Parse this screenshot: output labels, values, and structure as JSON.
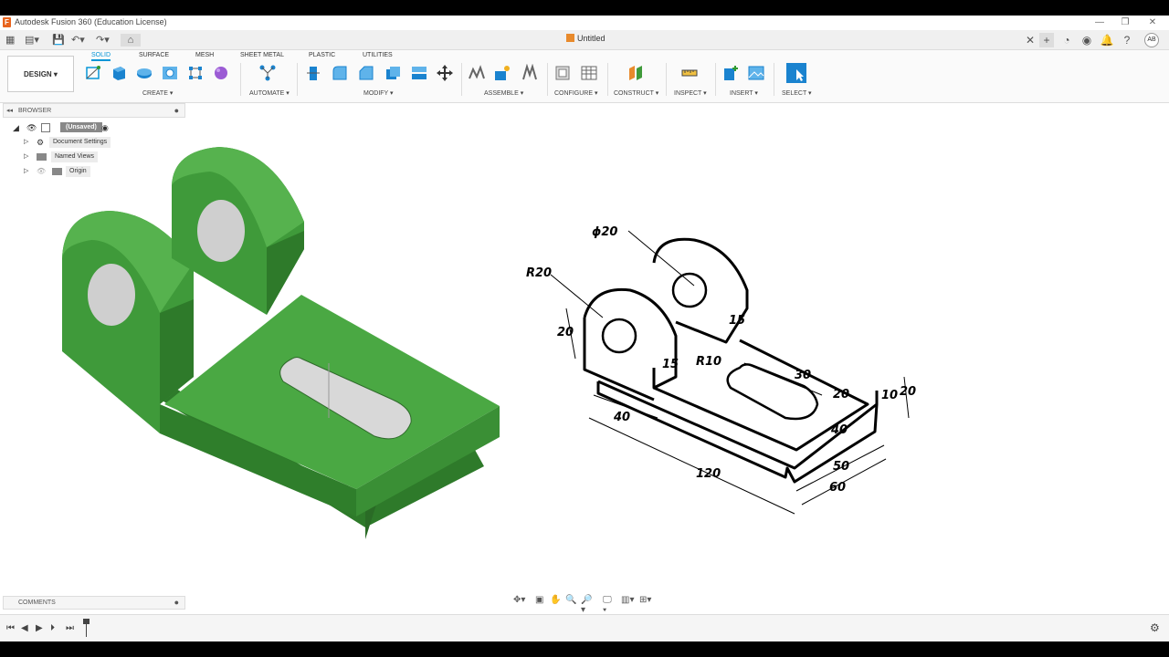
{
  "window": {
    "title": "Autodesk Fusion 360 (Education License)"
  },
  "document": {
    "title": "Untitled"
  },
  "user": {
    "initials": "AB"
  },
  "workspace": {
    "label": "DESIGN"
  },
  "tabs": [
    "SOLID",
    "SURFACE",
    "MESH",
    "SHEET METAL",
    "PLASTIC",
    "UTILITIES"
  ],
  "groups": {
    "create": "CREATE",
    "automate": "AUTOMATE",
    "modify": "MODIFY",
    "assemble": "ASSEMBLE",
    "configure": "CONFIGURE",
    "construct": "CONSTRUCT",
    "inspect": "INSPECT",
    "insert": "INSERT",
    "select": "SELECT"
  },
  "browser": {
    "title": "BROWSER",
    "root": "(Unsaved)",
    "items": [
      "Document Settings",
      "Named Views",
      "Origin"
    ]
  },
  "comments": {
    "title": "COMMENTS"
  },
  "drawing": {
    "dims": [
      "ϕ20",
      "R20",
      "20",
      "15",
      "15",
      "R10",
      "30",
      "20",
      "10",
      "20",
      "40",
      "40",
      "50",
      "60",
      "120"
    ]
  },
  "colors": {
    "accent": "#0696d7",
    "model_green": "#3f9a3a",
    "model_green_dark": "#2e7a2a",
    "model_green_light": "#56b24e"
  }
}
